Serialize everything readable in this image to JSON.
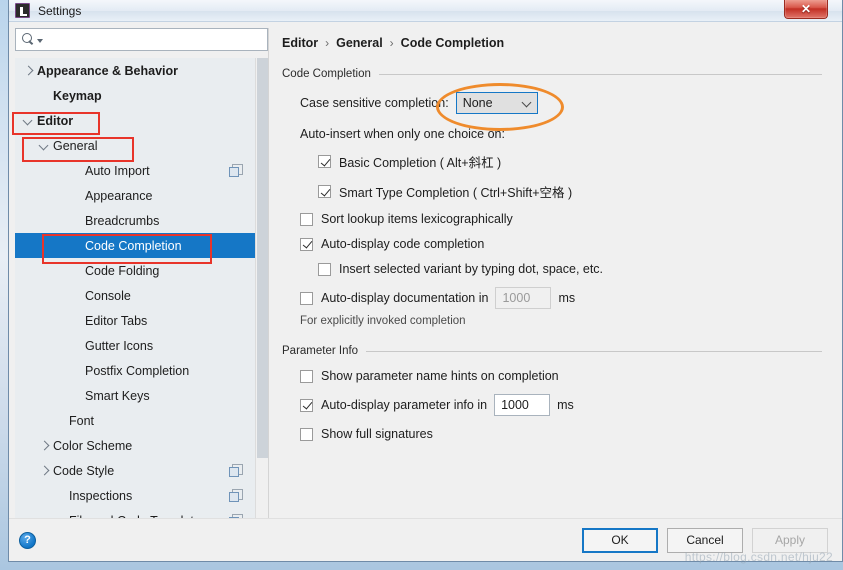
{
  "window": {
    "title": "Settings",
    "app_icon": "intellij-idea-icon",
    "close_label": "✕"
  },
  "search": {
    "value": "",
    "placeholder": "",
    "icon": "search-icon"
  },
  "sidebar": {
    "items": [
      {
        "label": "Appearance & Behavior",
        "indent": 0,
        "arrow": "right",
        "bold": true,
        "selected": false,
        "copy": false
      },
      {
        "label": "Keymap",
        "indent": 1,
        "arrow": "none",
        "bold": true,
        "selected": false,
        "copy": false
      },
      {
        "label": "Editor",
        "indent": 0,
        "arrow": "down",
        "bold": true,
        "selected": false,
        "copy": false
      },
      {
        "label": "General",
        "indent": 1,
        "arrow": "down",
        "bold": false,
        "selected": false,
        "copy": false
      },
      {
        "label": "Auto Import",
        "indent": 3,
        "arrow": "none",
        "bold": false,
        "selected": false,
        "copy": true
      },
      {
        "label": "Appearance",
        "indent": 3,
        "arrow": "none",
        "bold": false,
        "selected": false,
        "copy": false
      },
      {
        "label": "Breadcrumbs",
        "indent": 3,
        "arrow": "none",
        "bold": false,
        "selected": false,
        "copy": false
      },
      {
        "label": "Code Completion",
        "indent": 3,
        "arrow": "none",
        "bold": false,
        "selected": true,
        "copy": false
      },
      {
        "label": "Code Folding",
        "indent": 3,
        "arrow": "none",
        "bold": false,
        "selected": false,
        "copy": false
      },
      {
        "label": "Console",
        "indent": 3,
        "arrow": "none",
        "bold": false,
        "selected": false,
        "copy": false
      },
      {
        "label": "Editor Tabs",
        "indent": 3,
        "arrow": "none",
        "bold": false,
        "selected": false,
        "copy": false
      },
      {
        "label": "Gutter Icons",
        "indent": 3,
        "arrow": "none",
        "bold": false,
        "selected": false,
        "copy": false
      },
      {
        "label": "Postfix Completion",
        "indent": 3,
        "arrow": "none",
        "bold": false,
        "selected": false,
        "copy": false
      },
      {
        "label": "Smart Keys",
        "indent": 3,
        "arrow": "none",
        "bold": false,
        "selected": false,
        "copy": false
      },
      {
        "label": "Font",
        "indent": 2,
        "arrow": "none",
        "bold": false,
        "selected": false,
        "copy": false
      },
      {
        "label": "Color Scheme",
        "indent": 1,
        "arrow": "right",
        "bold": false,
        "selected": false,
        "copy": false
      },
      {
        "label": "Code Style",
        "indent": 1,
        "arrow": "right",
        "bold": false,
        "selected": false,
        "copy": true
      },
      {
        "label": "Inspections",
        "indent": 2,
        "arrow": "none",
        "bold": false,
        "selected": false,
        "copy": true
      },
      {
        "label": "File and Code Templates",
        "indent": 2,
        "arrow": "none",
        "bold": false,
        "selected": false,
        "copy": true
      }
    ]
  },
  "breadcrumb": {
    "items": [
      "Editor",
      "General",
      "Code Completion"
    ],
    "separator": "›"
  },
  "main": {
    "group_code_completion": "Code Completion",
    "case_sensitive_label": "Case sensitive completion:",
    "case_sensitive_value": "None",
    "auto_insert_label": "Auto-insert when only one choice on:",
    "options": [
      {
        "label": "Basic Completion ( Alt+斜杠 )",
        "checked": true,
        "indent": 2
      },
      {
        "label": "Smart Type Completion ( Ctrl+Shift+空格 )",
        "checked": true,
        "indent": 2
      },
      {
        "label": "Sort lookup items lexicographically",
        "checked": false,
        "indent": 1
      },
      {
        "label": "Auto-display code completion",
        "checked": true,
        "indent": 1
      },
      {
        "label": "Insert selected variant by typing dot, space, etc.",
        "checked": false,
        "indent": 2
      }
    ],
    "doc_label": "Auto-display documentation in",
    "doc_checked": false,
    "doc_value": "1000",
    "doc_unit": "ms",
    "doc_hint": "For explicitly invoked completion",
    "group_parameter_info": "Parameter Info",
    "param_options": [
      {
        "label": "Show parameter name hints on completion",
        "checked": false
      },
      {
        "label": "Show full signatures",
        "checked": false
      }
    ],
    "param_autodisplay_label": "Auto-display parameter info in",
    "param_autodisplay_checked": true,
    "param_value": "1000",
    "param_unit": "ms"
  },
  "footer": {
    "help_icon": "help-icon",
    "help_glyph": "?",
    "ok_label": "OK",
    "cancel_label": "Cancel",
    "apply_label": "Apply"
  },
  "annotations": {
    "watermark": "https://blog.csdn.net/hju22",
    "box_color": "#e8342a",
    "ellipse_color": "#ef8b2c"
  }
}
